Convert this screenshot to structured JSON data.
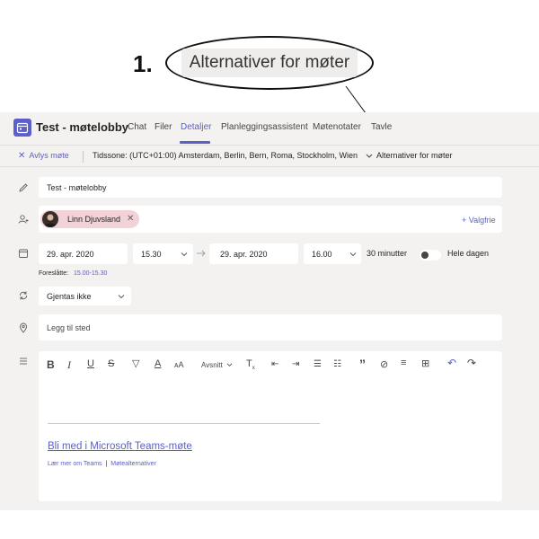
{
  "annotation": {
    "step_number": "1.",
    "callout_text": "Alternativer for møter"
  },
  "header": {
    "meeting_title": "Test - møtelobby",
    "tabs": [
      {
        "label": "Chat",
        "active": false
      },
      {
        "label": "Filer",
        "active": false
      },
      {
        "label": "Detaljer",
        "active": true
      },
      {
        "label": "Planleggingsassistent",
        "active": false
      },
      {
        "label": "Møtenotater",
        "active": false
      },
      {
        "label": "Tavle",
        "active": false
      }
    ]
  },
  "toolbar": {
    "cancel_label": "Avlys møte",
    "timezone_label": "Tidssone: (UTC+01:00) Amsterdam, Berlin, Bern, Roma, Stockholm, Wien",
    "meeting_options_label": "Alternativer for møter"
  },
  "form": {
    "title_value": "Test - møtelobby",
    "attendee_name": "Linn Djuvsland",
    "optional_label": "+ Valgfrie",
    "start_date": "29. apr. 2020",
    "start_time": "15.30",
    "end_date": "29. apr. 2020",
    "end_time": "16.00",
    "duration": "30 minutter",
    "all_day_label": "Hele dagen",
    "suggested_label": "Foreslåtte:",
    "suggested_time": "15.00-15.30",
    "recurrence_value": "Gjentas ikke",
    "location_placeholder": "Legg til sted"
  },
  "editor": {
    "paragraph_label": "Avsnitt",
    "join_link": "Bli med i Microsoft Teams-møte",
    "learn_more": "Lær mer om Teams",
    "separator": "|",
    "meeting_options_link": "Møtealternativer"
  },
  "colors": {
    "accent": "#5b5fc7",
    "chip_bg": "#f2d2d6",
    "app_bg": "#f3f2f1"
  }
}
